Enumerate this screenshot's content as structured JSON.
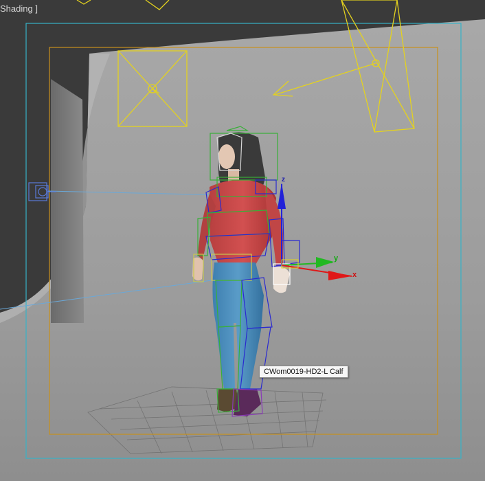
{
  "viewport": {
    "shading_label": "Shading ]"
  },
  "tooltip": {
    "text": "CWom0019-HD2-L Calf"
  },
  "gizmo": {
    "axis_x": "x",
    "axis_y": "y",
    "axis_z": "z"
  },
  "colors": {
    "background": "#3c3c3c",
    "backdrop": "#9a9a9a",
    "safe_frame_outer": "#36b3c8",
    "safe_frame_inner": "#c8911c",
    "light": "#e4d21e",
    "selection_bones": "#2a2ad0",
    "gizmo_x": "#e01818",
    "gizmo_y": "#22b822",
    "gizmo_z": "#2222d8"
  }
}
